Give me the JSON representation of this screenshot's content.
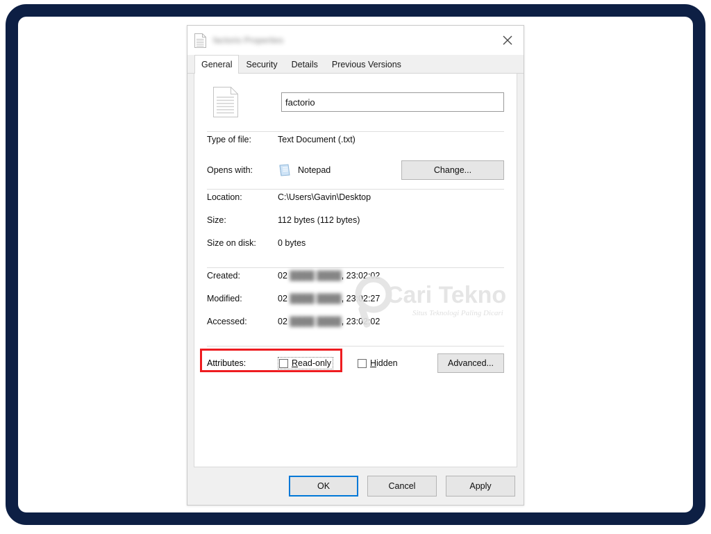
{
  "window": {
    "title_redacted": "factorio Properties",
    "close_icon": "close-icon",
    "titlebar_icon": "text-document-icon"
  },
  "tabs": [
    {
      "label": "General",
      "active": true
    },
    {
      "label": "Security",
      "active": false
    },
    {
      "label": "Details",
      "active": false
    },
    {
      "label": "Previous Versions",
      "active": false
    }
  ],
  "general": {
    "file_icon": "text-document-icon",
    "file_name": "factorio",
    "fields_top": [
      {
        "label": "Type of file:",
        "value": "Text Document (.txt)"
      }
    ],
    "opens_with": {
      "label": "Opens with:",
      "app_icon": "notepad-icon",
      "app_name": "Notepad",
      "change_button": "Change..."
    },
    "fields_location": [
      {
        "label": "Location:",
        "value": "C:\\Users\\Gavin\\Desktop"
      },
      {
        "label": "Size:",
        "value": "112 bytes (112 bytes)"
      },
      {
        "label": "Size on disk:",
        "value": "0 bytes"
      }
    ],
    "fields_dates": [
      {
        "label": "Created:",
        "prefix": "02 ",
        "redacted": "████ ████",
        "suffix": ", 23:02:02"
      },
      {
        "label": "Modified:",
        "prefix": "02 ",
        "redacted": "████ ████",
        "suffix": ", 23:02:27"
      },
      {
        "label": "Accessed:",
        "prefix": "02 ",
        "redacted": "████ ████",
        "suffix": ", 23:02:02"
      }
    ],
    "attributes": {
      "label": "Attributes:",
      "readonly": {
        "label_before": "R",
        "label_after": "ead-only",
        "checked": false
      },
      "hidden": {
        "label_before": "H",
        "label_after": "idden",
        "checked": false
      },
      "advanced_button": "Advanced..."
    }
  },
  "footer": {
    "ok": "OK",
    "cancel": "Cancel",
    "apply": "Apply"
  },
  "watermark": {
    "brand": "ari Tekno",
    "brand_lead": "C",
    "tagline": "Situs Teknologi Paling Dicari"
  },
  "colors": {
    "frame": "#0d1f44",
    "accent_focus": "#0078d7",
    "annotation_red": "#ee1c20",
    "dialog_bg": "#f0f0f0",
    "panel_bg": "#ffffff"
  }
}
